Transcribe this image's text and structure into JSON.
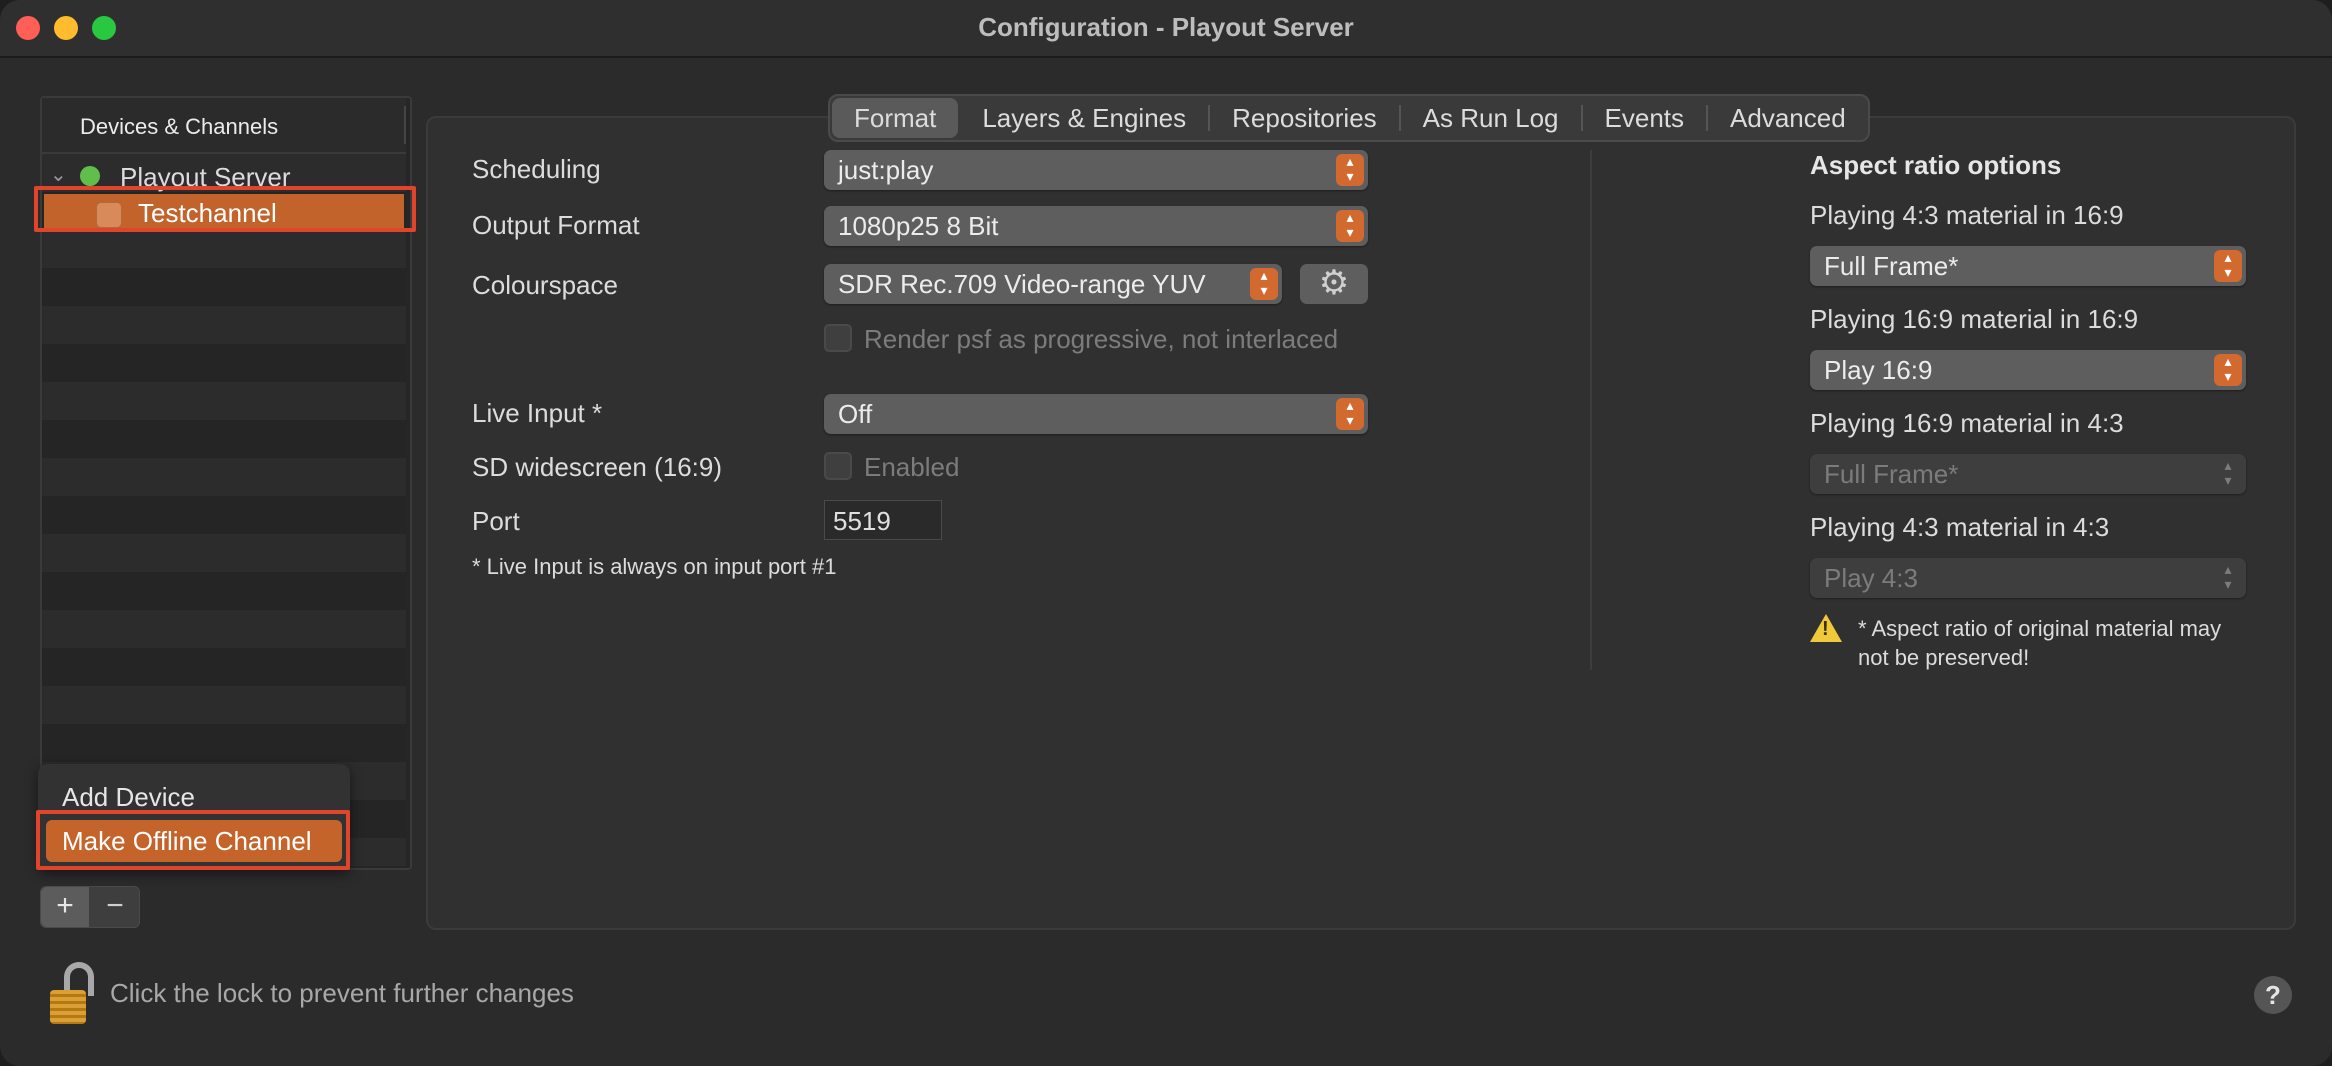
{
  "window": {
    "title": "Configuration - Playout Server"
  },
  "sidebar": {
    "header": "Devices & Channels",
    "server": {
      "label": "Playout Server",
      "status_color": "#5fbf4a"
    },
    "channel": {
      "label": "Testchannel"
    }
  },
  "popup_menu": {
    "items": [
      "Add Device",
      "Make Offline Channel"
    ],
    "selected": "Make Offline Channel"
  },
  "sidebar_buttons": {
    "plus": "+",
    "minus": "−"
  },
  "tabs": [
    "Format",
    "Layers & Engines",
    "Repositories",
    "As Run Log",
    "Events",
    "Advanced"
  ],
  "active_tab": "Format",
  "format": {
    "scheduling": {
      "label": "Scheduling",
      "value": "just:play"
    },
    "output_format": {
      "label": "Output Format",
      "value": "1080p25 8 Bit"
    },
    "colourspace": {
      "label": "Colourspace",
      "value": "SDR Rec.709 Video-range YUV"
    },
    "render_psf": {
      "label": "Render psf as progressive, not interlaced",
      "checked": false
    },
    "live_input": {
      "label": "Live Input *",
      "value": "Off"
    },
    "sd_widescreen": {
      "label": "SD widescreen (16:9)",
      "checkbox_label": "Enabled",
      "checked": false
    },
    "port": {
      "label": "Port",
      "value": "5519"
    },
    "note": "* Live Input is always on input port #1"
  },
  "aspect": {
    "title": "Aspect ratio options",
    "options": [
      {
        "label": "Playing 4:3 material in 16:9",
        "value": "Full Frame*",
        "enabled": true
      },
      {
        "label": "Playing 16:9 material in 16:9",
        "value": "Play 16:9",
        "enabled": true
      },
      {
        "label": "Playing 16:9 material in 4:3",
        "value": "Full Frame*",
        "enabled": false
      },
      {
        "label": "Playing 4:3 material in 4:3",
        "value": "Play 4:3",
        "enabled": false
      }
    ],
    "warning": "* Aspect ratio of original material may not be preserved!"
  },
  "footer": {
    "lock_text": "Click the lock to prevent further changes",
    "help": "?"
  },
  "colors": {
    "accent": "#c4632a",
    "highlight_border": "#e0452b",
    "warning": "#f0c93a"
  }
}
